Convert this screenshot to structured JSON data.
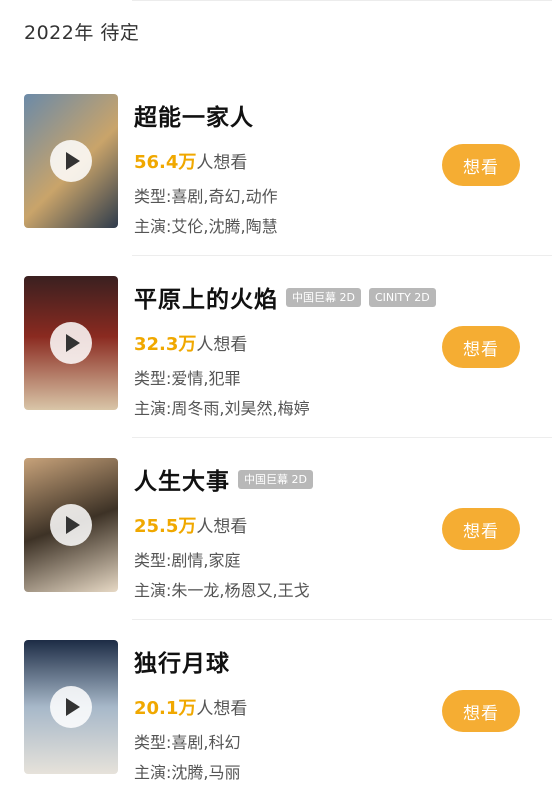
{
  "section_header": "2022年 待定",
  "want_suffix": "人想看",
  "button_label": "想看",
  "genre_prefix": "类型:",
  "cast_prefix": "主演:",
  "movies": [
    {
      "title": "超能一家人",
      "tags": [],
      "want_count": "56.4万",
      "genre": "喜剧,奇幻,动作",
      "cast": "艾伦,沈腾,陶慧",
      "poster_colors": [
        "#6b8aa8",
        "#c9a46a",
        "#2e3b4c"
      ]
    },
    {
      "title": "平原上的火焰",
      "tags": [
        "中国巨幕 2D",
        "CINITY 2D"
      ],
      "want_count": "32.3万",
      "genre": "爱情,犯罪",
      "cast": "周冬雨,刘昊然,梅婷",
      "poster_colors": [
        "#3a2020",
        "#8a2a20",
        "#d9c6a8"
      ]
    },
    {
      "title": "人生大事",
      "tags": [
        "中国巨幕 2D"
      ],
      "want_count": "25.5万",
      "genre": "剧情,家庭",
      "cast": "朱一龙,杨恩又,王戈",
      "poster_colors": [
        "#c7a27a",
        "#3d3226",
        "#e7d9c5"
      ]
    },
    {
      "title": "独行月球",
      "tags": [],
      "want_count": "20.1万",
      "genre": "喜剧,科幻",
      "cast": "沈腾,马丽",
      "poster_colors": [
        "#1d2c45",
        "#a7b8c9",
        "#e6e2da"
      ]
    }
  ]
}
